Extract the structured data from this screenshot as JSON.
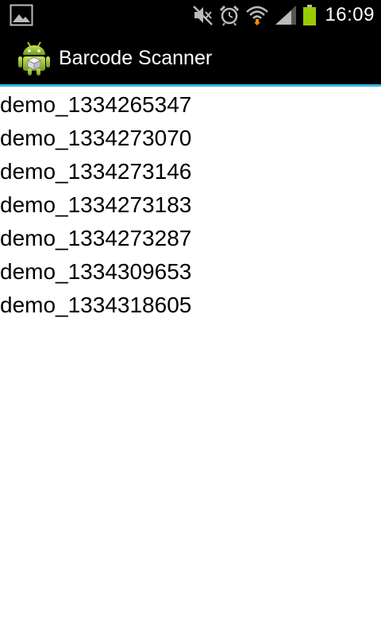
{
  "status_bar": {
    "time": "16:09",
    "icons": [
      "image-notification-icon",
      "mute-icon",
      "alarm-icon",
      "wifi-icon",
      "signal-icon",
      "battery-icon"
    ],
    "battery_color": "#99cc00"
  },
  "app_bar": {
    "title": "Barcode Scanner",
    "icon": "android-robot-icon",
    "accent_color": "#33b5e5"
  },
  "list": {
    "items": [
      "demo_1334265347",
      "demo_1334273070",
      "demo_1334273146",
      "demo_1334273183",
      "demo_1334273287",
      "demo_1334309653",
      "demo_1334318605"
    ]
  }
}
